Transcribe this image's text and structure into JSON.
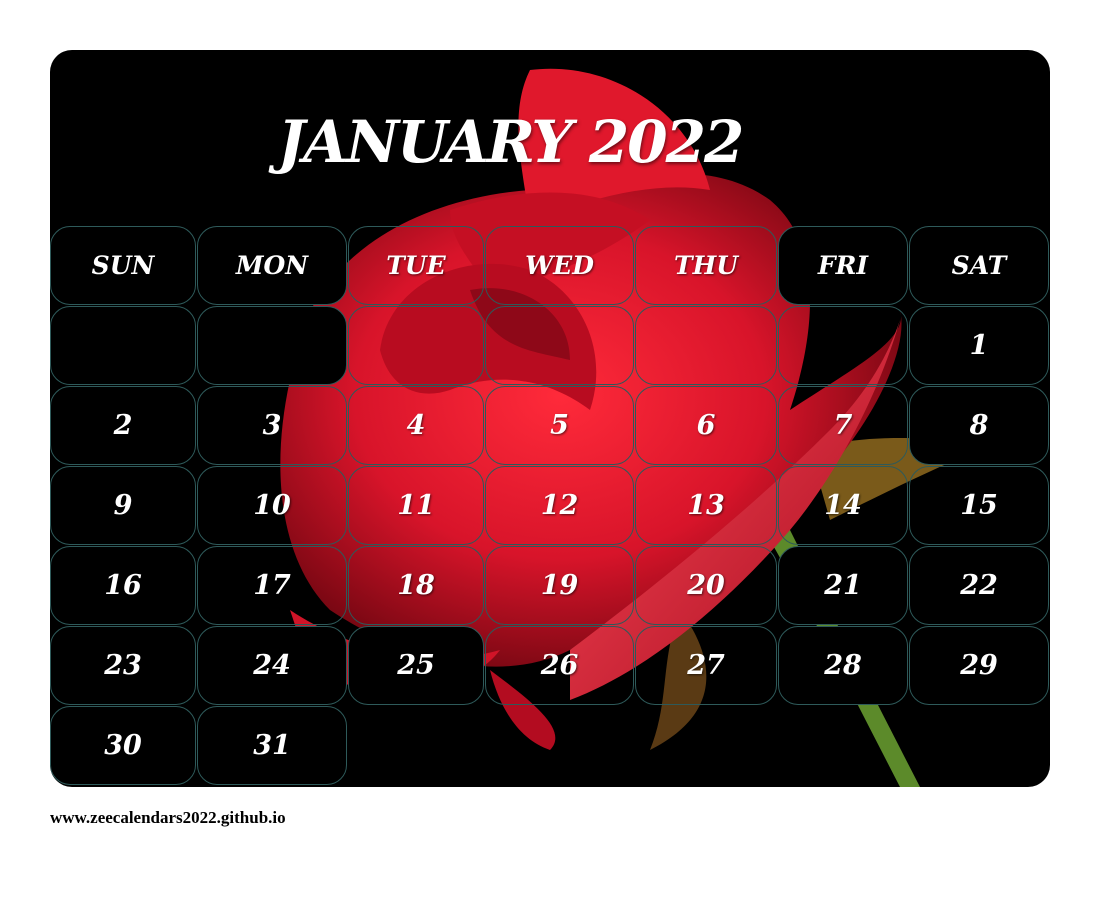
{
  "calendar": {
    "title": "JANUARY 2022",
    "weekdays": [
      "SUN",
      "MON",
      "TUE",
      "WED",
      "THU",
      "FRI",
      "SAT"
    ],
    "weeks": [
      [
        "",
        "",
        "",
        "",
        "",
        "",
        "1"
      ],
      [
        "2",
        "3",
        "4",
        "5",
        "6",
        "7",
        "8"
      ],
      [
        "9",
        "10",
        "11",
        "12",
        "13",
        "14",
        "15"
      ],
      [
        "16",
        "17",
        "18",
        "19",
        "20",
        "21",
        "22"
      ],
      [
        "23",
        "24",
        "25",
        "26",
        "27",
        "28",
        "29"
      ],
      [
        "30",
        "31",
        "",
        "",
        "",
        "",
        ""
      ]
    ]
  },
  "footer": {
    "url": "www.zeecalendars2022.github.io"
  },
  "colors": {
    "background": "#000000",
    "cell_border": "#2e5a5a",
    "text": "#ffffff",
    "rose": "#d8142a"
  }
}
